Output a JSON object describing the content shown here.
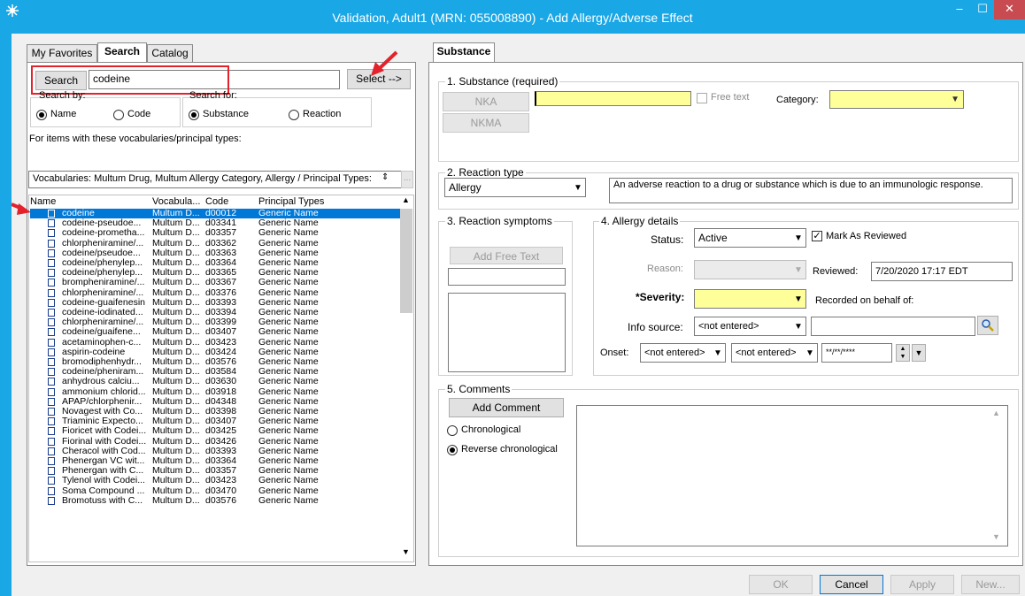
{
  "window": {
    "title": "Validation, Adult1 (MRN: 055008890) - Add Allergy/Adverse Effect",
    "icon": "app-star-icon",
    "min_glyph": "–",
    "max_glyph": "☐",
    "close_glyph": "✕"
  },
  "left_tabs": [
    "My Favorites",
    "Search",
    "Catalog"
  ],
  "search": {
    "button_label": "Search",
    "query": "codeine",
    "select_label": "Select -->",
    "search_by_label": "Search by:",
    "search_for_label": "Search for:",
    "by_name": "Name",
    "by_code": "Code",
    "for_substance": "Substance",
    "for_reaction": "Reaction",
    "vocab_hint": "For items with these vocabularies/principal types:",
    "vocab_value": "Vocabularies: Multum Drug, Multum Allergy Category, Allergy / Principal Types:",
    "ellipsis": "..."
  },
  "results": {
    "columns": [
      "Name",
      "Vocabula...",
      "Code",
      "Principal Types"
    ],
    "rows": [
      [
        "codeine",
        "Multum D...",
        "d00012",
        "Generic Name"
      ],
      [
        "codeine-pseudoe...",
        "Multum D...",
        "d03341",
        "Generic Name"
      ],
      [
        "codeine-prometha...",
        "Multum D...",
        "d03357",
        "Generic Name"
      ],
      [
        "chlorpheniramine/...",
        "Multum D...",
        "d03362",
        "Generic Name"
      ],
      [
        "codeine/pseudoe...",
        "Multum D...",
        "d03363",
        "Generic Name"
      ],
      [
        "codeine/phenylep...",
        "Multum D...",
        "d03364",
        "Generic Name"
      ],
      [
        "codeine/phenylep...",
        "Multum D...",
        "d03365",
        "Generic Name"
      ],
      [
        "brompheniramine/...",
        "Multum D...",
        "d03367",
        "Generic Name"
      ],
      [
        "chlorpheniramine/...",
        "Multum D...",
        "d03376",
        "Generic Name"
      ],
      [
        "codeine-guaifenesin",
        "Multum D...",
        "d03393",
        "Generic Name"
      ],
      [
        "codeine-iodinated...",
        "Multum D...",
        "d03394",
        "Generic Name"
      ],
      [
        "chlorpheniramine/...",
        "Multum D...",
        "d03399",
        "Generic Name"
      ],
      [
        "codeine/guaifene...",
        "Multum D...",
        "d03407",
        "Generic Name"
      ],
      [
        "acetaminophen-c...",
        "Multum D...",
        "d03423",
        "Generic Name"
      ],
      [
        "aspirin-codeine",
        "Multum D...",
        "d03424",
        "Generic Name"
      ],
      [
        "bromodiphenhydr...",
        "Multum D...",
        "d03576",
        "Generic Name"
      ],
      [
        "codeine/pheniram...",
        "Multum D...",
        "d03584",
        "Generic Name"
      ],
      [
        "anhydrous calciu...",
        "Multum D...",
        "d03630",
        "Generic Name"
      ],
      [
        "ammonium chlorid...",
        "Multum D...",
        "d03918",
        "Generic Name"
      ],
      [
        "APAP/chlorphenir...",
        "Multum D...",
        "d04348",
        "Generic Name"
      ],
      [
        "Novagest with Co...",
        "Multum D...",
        "d03398",
        "Generic Name"
      ],
      [
        "Triaminic Expecto...",
        "Multum D...",
        "d03407",
        "Generic Name"
      ],
      [
        "Fioricet with Codei...",
        "Multum D...",
        "d03425",
        "Generic Name"
      ],
      [
        "Fiorinal with Codei...",
        "Multum D...",
        "d03426",
        "Generic Name"
      ],
      [
        "Cheracol with Cod...",
        "Multum D...",
        "d03393",
        "Generic Name"
      ],
      [
        "Phenergan VC wit...",
        "Multum D...",
        "d03364",
        "Generic Name"
      ],
      [
        "Phenergan with C...",
        "Multum D...",
        "d03357",
        "Generic Name"
      ],
      [
        "Tylenol with Codei...",
        "Multum D...",
        "d03423",
        "Generic Name"
      ],
      [
        "Soma Compound ...",
        "Multum D...",
        "d03470",
        "Generic Name"
      ],
      [
        "Bromotuss with C...",
        "Multum D...",
        "d03576",
        "Generic Name"
      ]
    ]
  },
  "right_tab": "Substance",
  "substance": {
    "section_label": "1. Substance (required)",
    "nka": "NKA",
    "nkma": "NKMA",
    "free_text": "Free text",
    "category_label": "Category:"
  },
  "reaction_type": {
    "section_label": "2. Reaction type",
    "value": "Allergy",
    "description": "An adverse reaction to a drug or substance which is due to an immunologic response."
  },
  "symptoms": {
    "section_label": "3. Reaction symptoms",
    "add_free_text": "Add Free Text"
  },
  "details": {
    "section_label": "4. Allergy details",
    "status_label": "Status:",
    "status_value": "Active",
    "mark_reviewed": "Mark As Reviewed",
    "reason_label": "Reason:",
    "reviewed_label": "Reviewed:",
    "reviewed_value": "7/20/2020 17:17 EDT",
    "severity_label": "*Severity:",
    "recorded_label": "Recorded on behalf of:",
    "info_source_label": "Info source:",
    "info_source_value": "<not entered>",
    "onset_label": "Onset:",
    "onset_1": "<not entered>",
    "onset_2": "<not entered>",
    "onset_date": "**/**/****"
  },
  "comments": {
    "section_label": "5. Comments",
    "add_comment": "Add Comment",
    "chronological": "Chronological",
    "reverse": "Reverse chronological"
  },
  "footer": {
    "ok": "OK",
    "cancel": "Cancel",
    "apply": "Apply",
    "new": "New..."
  },
  "colors": {
    "title_bar": "#1aa7e6",
    "selection": "#0078d7",
    "required_field": "#ffff99",
    "annotation": "#e3232c"
  }
}
